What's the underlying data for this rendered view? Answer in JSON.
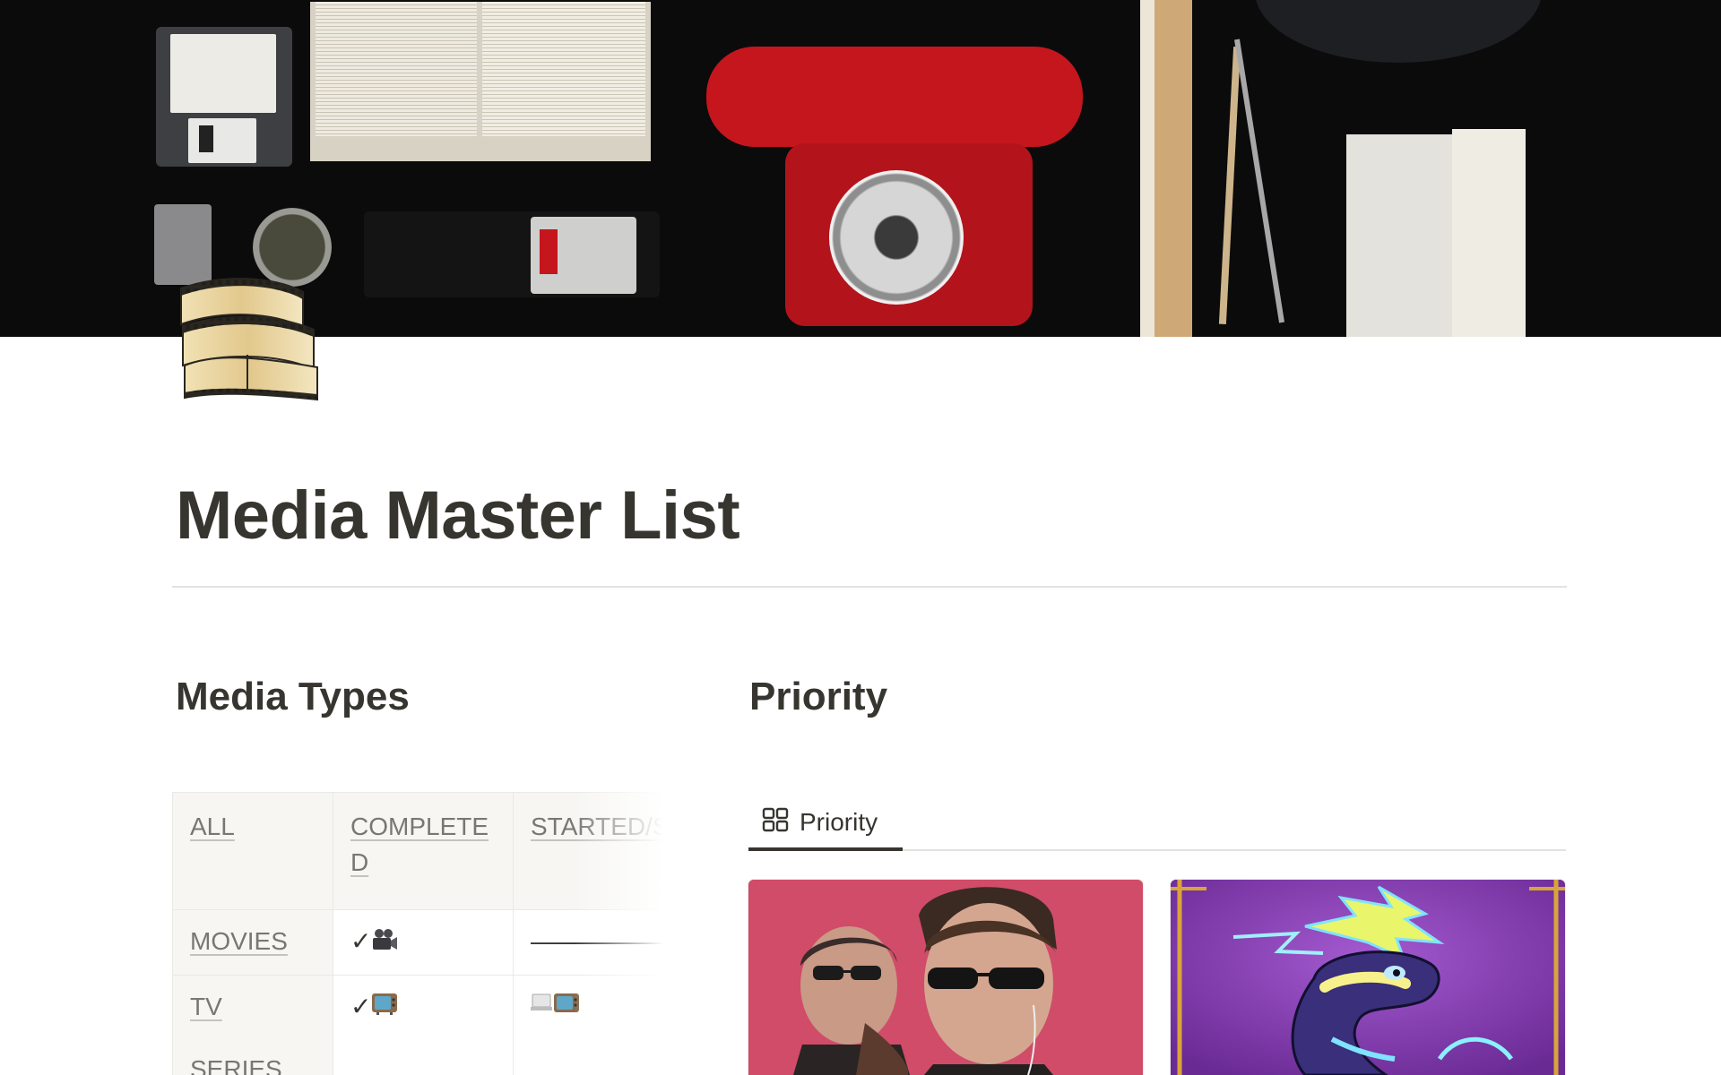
{
  "page": {
    "title": "Media Master List",
    "icon": "film-strip-icon"
  },
  "cover": {
    "description_icons": [
      "floppy-disk",
      "open-book",
      "red-rotary-phone",
      "light-meter",
      "ruler",
      "drafting-compass",
      "newspaper"
    ]
  },
  "media_types": {
    "heading": "Media Types",
    "columns": [
      "ALL",
      "COMPLETED",
      "STARTED/S"
    ],
    "rows": [
      {
        "label": "MOVIES",
        "completed": "✓",
        "completed_icon": "movie-camera-icon",
        "started": "———————",
        "started_icon": ""
      },
      {
        "label": "TV SERIES",
        "completed": "✓",
        "completed_icon": "tv-icon",
        "started": "",
        "started_icon": "laptop-tv-icon"
      }
    ]
  },
  "priority": {
    "heading": "Priority",
    "view_tab": {
      "label": "Priority",
      "icon": "gallery-grid-icon"
    },
    "cards": [
      {
        "image": "movie-poster-two-men-sunglasses",
        "bg": "#cf4a66"
      },
      {
        "image": "game-art-purple-dragon",
        "bg": "#8a3fae"
      }
    ]
  },
  "colors": {
    "text": "#37352f",
    "muted": "#787774",
    "divider": "#e3e2e0"
  }
}
